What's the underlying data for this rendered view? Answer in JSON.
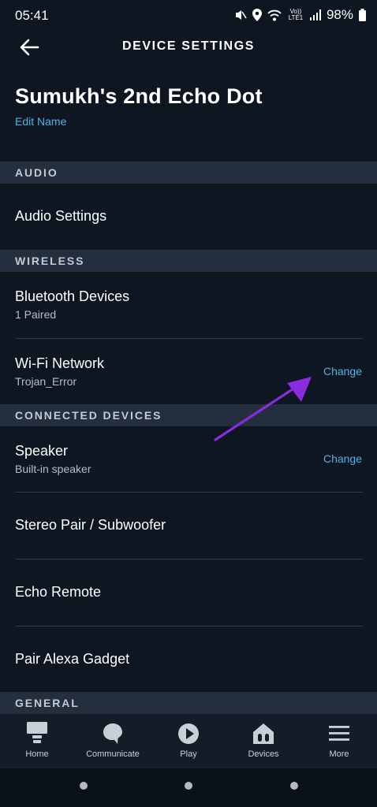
{
  "status_bar": {
    "time": "05:41",
    "battery": "98%",
    "network_label": "Vo)) LTE1"
  },
  "header": {
    "title": "DEVICE SETTINGS"
  },
  "device": {
    "name": "Sumukh's 2nd Echo Dot",
    "edit_label": "Edit Name"
  },
  "sections": {
    "audio": {
      "title": "AUDIO",
      "rows": [
        {
          "title": "Audio Settings"
        }
      ]
    },
    "wireless": {
      "title": "WIRELESS",
      "rows": [
        {
          "title": "Bluetooth Devices",
          "subtitle": "1 Paired"
        },
        {
          "title": "Wi-Fi Network",
          "subtitle": "Trojan_Error",
          "action": "Change"
        }
      ]
    },
    "connected": {
      "title": "CONNECTED DEVICES",
      "rows": [
        {
          "title": "Speaker",
          "subtitle": "Built-in speaker",
          "action": "Change"
        },
        {
          "title": "Stereo Pair / Subwoofer"
        },
        {
          "title": "Echo Remote"
        },
        {
          "title": "Pair Alexa Gadget"
        }
      ]
    },
    "general": {
      "title": "GENERAL"
    }
  },
  "bottom_nav": [
    {
      "label": "Home",
      "icon": "home-icon"
    },
    {
      "label": "Communicate",
      "icon": "chat-bubble-icon"
    },
    {
      "label": "Play",
      "icon": "play-icon"
    },
    {
      "label": "Devices",
      "icon": "devices-icon"
    },
    {
      "label": "More",
      "icon": "menu-icon"
    }
  ],
  "colors": {
    "background": "#0e1621",
    "section": "#232f3e",
    "accent": "#4fb3ea",
    "annotation_arrow": "#8a2be2"
  }
}
